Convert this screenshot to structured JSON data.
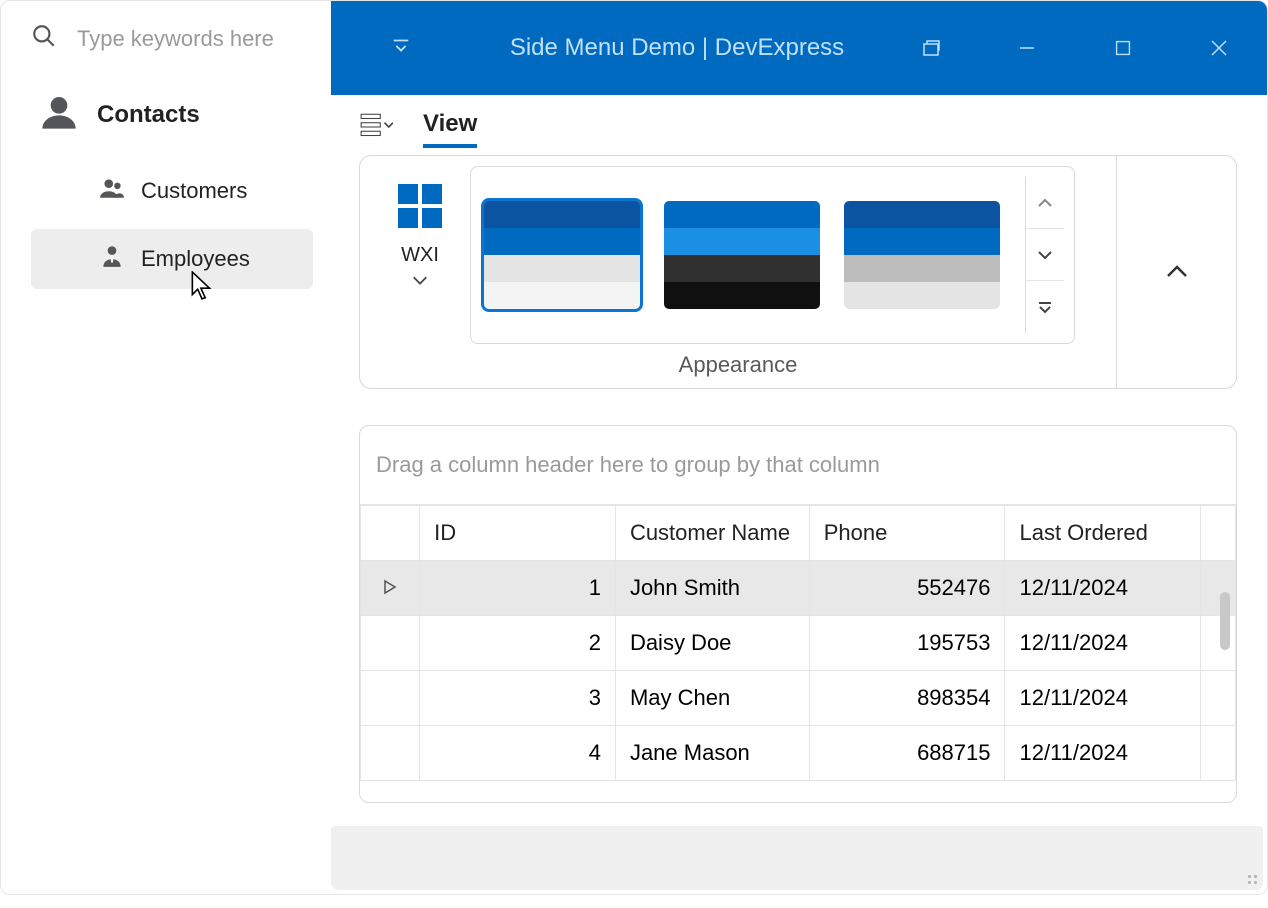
{
  "search": {
    "placeholder": "Type keywords here"
  },
  "sidebar": {
    "group_title": "Contacts",
    "items": [
      {
        "label": "Customers"
      },
      {
        "label": "Employees"
      }
    ]
  },
  "titlebar": {
    "title": "Side Menu Demo | DevExpress"
  },
  "ribbon": {
    "tab_label": "View",
    "skin_launcher_label": "WXI",
    "group_label": "Appearance",
    "swatches": [
      {
        "bands": [
          "#0a54a1",
          "#0069c0",
          "#e5e5e5",
          "#f4f4f4"
        ],
        "selected": true
      },
      {
        "bands": [
          "#0069c0",
          "#1a8fe3",
          "#303030",
          "#101010"
        ],
        "selected": false
      },
      {
        "bands": [
          "#0a54a1",
          "#0069c0",
          "#bcbcbc",
          "#e4e4e4"
        ],
        "selected": false
      }
    ]
  },
  "grid": {
    "group_panel_text": "Drag a column header here to group by that column",
    "columns": {
      "id": "ID",
      "name": "Customer Name",
      "phone": "Phone",
      "last": "Last Ordered"
    },
    "rows": [
      {
        "id": "1",
        "name": "John Smith",
        "phone": "552476",
        "last": "12/11/2024",
        "selected": true
      },
      {
        "id": "2",
        "name": "Daisy Doe",
        "phone": "195753",
        "last": "12/11/2024",
        "selected": false
      },
      {
        "id": "3",
        "name": "May Chen",
        "phone": "898354",
        "last": "12/11/2024",
        "selected": false
      },
      {
        "id": "4",
        "name": "Jane Mason",
        "phone": "688715",
        "last": "12/11/2024",
        "selected": false
      }
    ]
  }
}
